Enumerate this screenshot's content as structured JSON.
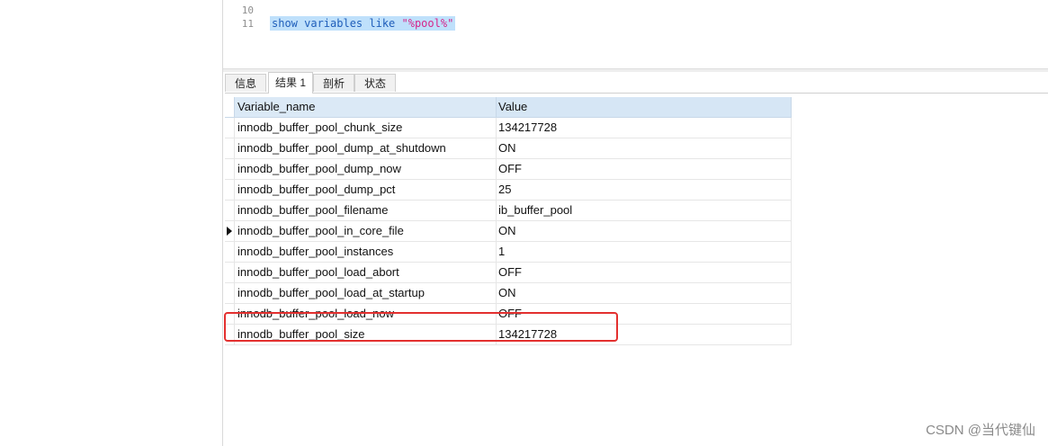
{
  "editor": {
    "line_numbers": [
      "10",
      "11"
    ],
    "query": {
      "keyword_part": "show variables like ",
      "string_part": "\"%pool%\""
    }
  },
  "tabs": [
    {
      "label": "信息",
      "active": false
    },
    {
      "label": "结果 1",
      "active": true
    },
    {
      "label": "剖析",
      "active": false
    },
    {
      "label": "状态",
      "active": false
    }
  ],
  "grid": {
    "columns": [
      "Variable_name",
      "Value"
    ],
    "current_row_index": 5,
    "highlighted_row_index": 10,
    "rows": [
      {
        "name": "innodb_buffer_pool_chunk_size",
        "value": "134217728"
      },
      {
        "name": "innodb_buffer_pool_dump_at_shutdown",
        "value": "ON"
      },
      {
        "name": "innodb_buffer_pool_dump_now",
        "value": "OFF"
      },
      {
        "name": "innodb_buffer_pool_dump_pct",
        "value": "25"
      },
      {
        "name": "innodb_buffer_pool_filename",
        "value": "ib_buffer_pool"
      },
      {
        "name": "innodb_buffer_pool_in_core_file",
        "value": "ON"
      },
      {
        "name": "innodb_buffer_pool_instances",
        "value": "1"
      },
      {
        "name": "innodb_buffer_pool_load_abort",
        "value": "OFF"
      },
      {
        "name": "innodb_buffer_pool_load_at_startup",
        "value": "ON"
      },
      {
        "name": "innodb_buffer_pool_load_now",
        "value": "OFF"
      },
      {
        "name": "innodb_buffer_pool_size",
        "value": "134217728"
      }
    ]
  },
  "colors": {
    "highlight_box": "#e3302f",
    "selection": "#bfe0fb",
    "keyword": "#1f5eba",
    "string": "#d6258b"
  },
  "watermark": "CSDN @当代键仙"
}
